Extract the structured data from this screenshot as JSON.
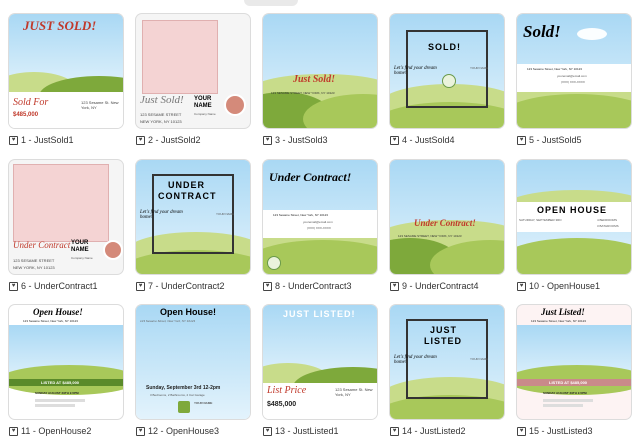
{
  "templates": [
    {
      "caption": "1 - JustSold1",
      "headline": "JUST SOLD!",
      "price_label": "Sold For",
      "price": "$485,000",
      "address": "123 Sesame St. New York, NY"
    },
    {
      "caption": "2 - JustSold2",
      "headline": "Just Sold!",
      "address_lines": [
        "123 SESAME STREET",
        "NEW YORK, NY 10123"
      ],
      "name_lines": [
        "YOUR",
        "NAME"
      ],
      "company": "Company Name"
    },
    {
      "caption": "3 - JustSold3",
      "headline": "Just Sold!",
      "address": "123 SESAME STREET, NEW YORK, NY 10123"
    },
    {
      "caption": "4 - JustSold4",
      "headline": "SOLD!",
      "tagline": "Let's find your dream home!",
      "name": "YOUR NAME"
    },
    {
      "caption": "5 - JustSold5",
      "headline": "Sold!",
      "address": "123 Sesame Street, New York, NY 10123",
      "email": "youremail@email.com",
      "phone": "(XXX) XXX-XXXX"
    },
    {
      "caption": "6 - UnderContract1",
      "headline": "Under Contract",
      "name_lines": [
        "YOUR",
        "NAME"
      ],
      "company": "Company Name",
      "address_lines": [
        "123 SESAME STREET",
        "NEW YORK, NY 10123"
      ]
    },
    {
      "caption": "7 - UnderContract2",
      "headline_lines": [
        "UNDER",
        "CONTRACT"
      ],
      "tagline": "Let's find your dream home!",
      "name": "YOUR NAME"
    },
    {
      "caption": "8 - UnderContract3",
      "headline": "Under Contract!",
      "address": "123 Sesame Street, New York, NY 10123",
      "email": "youremail@email.com",
      "phone": "(XXX) XXX-XXXX"
    },
    {
      "caption": "9 - UnderContract4",
      "headline": "Under Contract!",
      "address": "123 SESAME STREET, NEW YORK, NY 10123"
    },
    {
      "caption": "10 - OpenHouse1",
      "headline": "OPEN HOUSE",
      "date": "SATURDAY, SEPTEMBER 3RD",
      "beds": "4 BEDROOMS",
      "baths": "3 BATHROOMS"
    },
    {
      "caption": "11 - OpenHouse2",
      "headline": "Open House!",
      "address": "123 Sesame Street, New York, NY 10123",
      "listed": "LISTED AT $485,000",
      "date": "SUNDAY AUGUST 29TH 2-5PM"
    },
    {
      "caption": "12 - OpenHouse3",
      "headline": "Open House!",
      "address": "123 Sesame Street, New York, NY 10123",
      "date": "Sunday, September 3rd 12-2pm",
      "details": "3 Bedrooms, 2 Bathrooms, 2 Car Garage",
      "name": "YOUR NAME"
    },
    {
      "caption": "13 - JustListed1",
      "headline": "JUST LISTED!",
      "price_label": "List Price",
      "price": "$485,000",
      "address": "123 Sesame St. New York, NY"
    },
    {
      "caption": "14 - JustListed2",
      "headline_lines": [
        "JUST",
        "LISTED"
      ],
      "tagline": "Let's find your dream home!",
      "name": "YOUR NAME"
    },
    {
      "caption": "15 - JustListed3",
      "headline": "Just Listed!",
      "address": "123 Sesame Street, New York, NY 10123",
      "listed": "LISTED AT $485,000",
      "date": "SUNDAY AUGUST 29TH 2-5PM"
    }
  ]
}
